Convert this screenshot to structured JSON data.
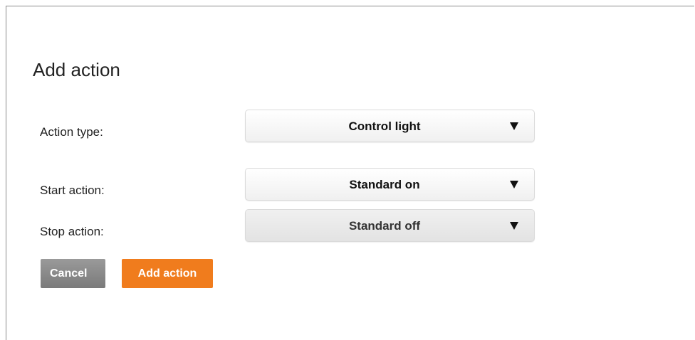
{
  "dialog": {
    "title": "Add action",
    "fields": [
      {
        "label": "Action type:",
        "value": "Control light",
        "icon": "triangle-down-icon"
      },
      {
        "label": "Start action:",
        "value": "Standard on",
        "icon": "triangle-down-icon"
      },
      {
        "label": "Stop action:",
        "value": "Standard off",
        "icon": "triangle-down-icon"
      }
    ],
    "buttons": {
      "cancel_label": "Cancel",
      "add_label": "Add action"
    },
    "colors": {
      "accent": "#f07c1d",
      "cancel": "#8a8a8a"
    }
  }
}
